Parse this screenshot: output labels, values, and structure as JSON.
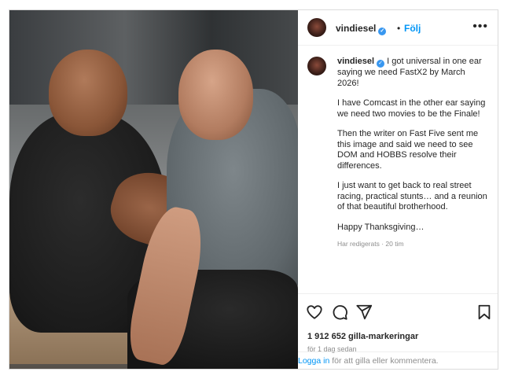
{
  "post": {
    "username": "vindiesel",
    "verified_mark": "✓",
    "dot": "•",
    "follow_label": "Följ",
    "more_label": "•••",
    "caption": {
      "username": "vindiesel",
      "paragraphs": [
        "I got universal in one ear saying we need FastX2 by March 2026!",
        "I have Comcast in the other ear saying we need two movies to be the Finale!",
        "Then the writer on Fast Five sent me this image and said we need to see DOM and HOBBS resolve their differences.",
        "I just want to get back to real street racing, practical stunts… and a reunion of that beautiful brotherhood.",
        "Happy Thanksgiving…"
      ],
      "meta": "Har redigerats · 20 tim"
    },
    "add_comment_icon": "+",
    "likes": "1 912 652 gilla-markeringar",
    "timestamp": "för 1 dag sedan",
    "login": {
      "link": "Logga in",
      "rest": " för att gilla eller kommentera."
    }
  },
  "icons": {
    "like": "heart-icon",
    "comment": "comment-icon",
    "share": "share-icon",
    "save": "bookmark-icon",
    "more": "more-icon",
    "add": "add-comment-icon"
  },
  "colors": {
    "accent": "#0095f6",
    "verified": "#3897f0",
    "text": "#262626",
    "muted": "#8e8e8e"
  }
}
